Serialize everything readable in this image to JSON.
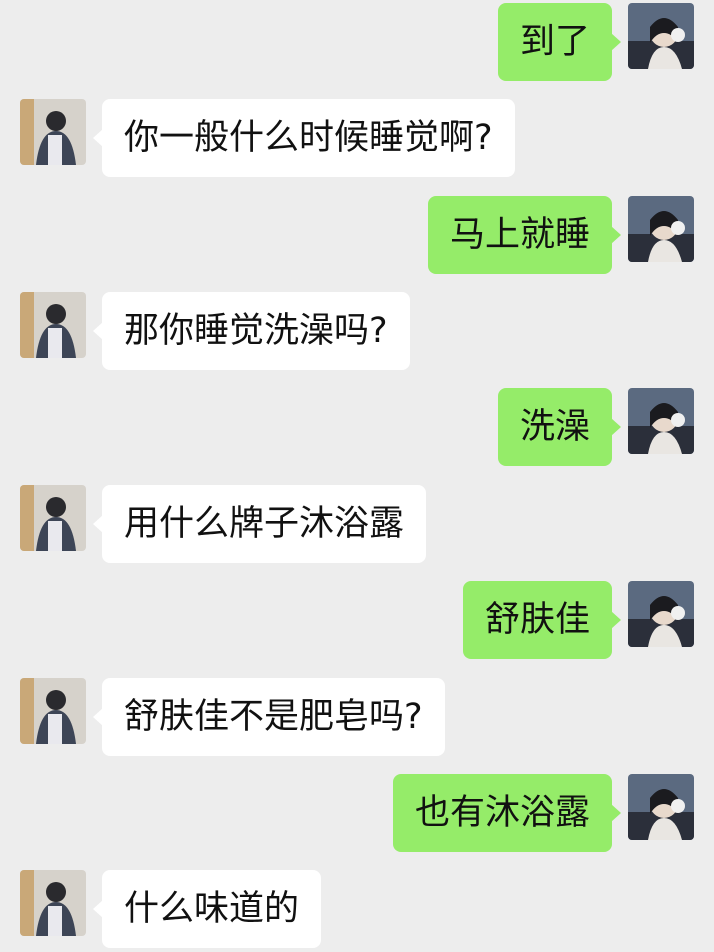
{
  "chat": {
    "background": "#ededed",
    "sent_bubble_color": "#95ec69",
    "received_bubble_color": "#ffffff",
    "messages": [
      {
        "side": "right",
        "text": "到了",
        "avatar": "girl-with-earmuffs-avatar"
      },
      {
        "side": "left",
        "text": "你一般什么时候睡觉啊?",
        "avatar": "boy-in-shirt-avatar"
      },
      {
        "side": "right",
        "text": "马上就睡",
        "avatar": "girl-with-earmuffs-avatar"
      },
      {
        "side": "left",
        "text": "那你睡觉洗澡吗?",
        "avatar": "boy-in-shirt-avatar"
      },
      {
        "side": "right",
        "text": "洗澡",
        "avatar": "girl-with-earmuffs-avatar"
      },
      {
        "side": "left",
        "text": "用什么牌子沐浴露",
        "avatar": "boy-in-shirt-avatar"
      },
      {
        "side": "right",
        "text": "舒肤佳",
        "avatar": "girl-with-earmuffs-avatar"
      },
      {
        "side": "left",
        "text": "舒肤佳不是肥皂吗?",
        "avatar": "boy-in-shirt-avatar"
      },
      {
        "side": "right",
        "text": "也有沐浴露",
        "avatar": "girl-with-earmuffs-avatar"
      },
      {
        "side": "left",
        "text": "什么味道的",
        "avatar": "boy-in-shirt-avatar"
      }
    ]
  }
}
